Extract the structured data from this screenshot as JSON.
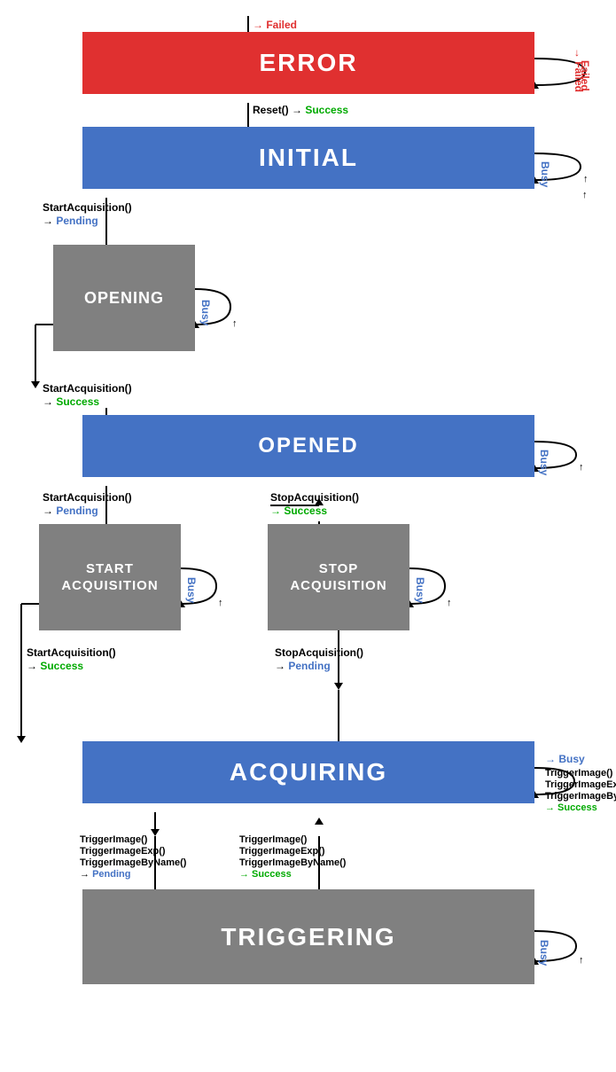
{
  "states": {
    "error": {
      "label": "ERROR",
      "bg": "red"
    },
    "initial": {
      "label": "INITIAL",
      "bg": "blue"
    },
    "opening": {
      "label": "OPENING",
      "bg": "gray"
    },
    "opened": {
      "label": "OPENED",
      "bg": "blue"
    },
    "startAcquisition": {
      "label": "START\nACQUISITION",
      "bg": "gray"
    },
    "stopAcquisition": {
      "label": "STOP\nACQUISITION",
      "bg": "gray"
    },
    "acquiring": {
      "label": "ACQUIRING",
      "bg": "blue"
    },
    "triggering": {
      "label": "TRIGGERING",
      "bg": "gray"
    }
  },
  "transitions": {
    "toError": "→ Failed",
    "errorSelf": "Failed",
    "resetSuccess": "Reset() → Success",
    "initialSelf": "Busy",
    "startAcqPending1": "StartAcquisition()\n→ Pending",
    "openingSelf": "Busy",
    "startAcqSuccess1": "StartAcquisition()\n→ Success",
    "openedSelf": "Busy",
    "startAcqPending2": "StartAcquisition()\n→ Pending",
    "startAcqSelf": "Busy",
    "stopAcqSuccess": "StopAcquisition()\n→ Success",
    "stopAcqSelf": "Busy",
    "startAcqSuccess2": "StartAcquisition()\n→ Success",
    "stopAcqPending": "StopAcquisition()\n→ Pending",
    "acquiringSelf": "Busy",
    "acquiringSuccess": "TriggerImage()\nTriggerImageExp()\nTriggerImageByName()\n→ Success",
    "triggerPending": "TriggerImage()\nTriggerImageExp()\nTriggerImageByName()\n→ Pending",
    "triggerSuccess": "TriggerImage()\nTriggerImageExp()\nTriggerImageByName()\n→ Success",
    "triggeringSelf": "Busy"
  }
}
